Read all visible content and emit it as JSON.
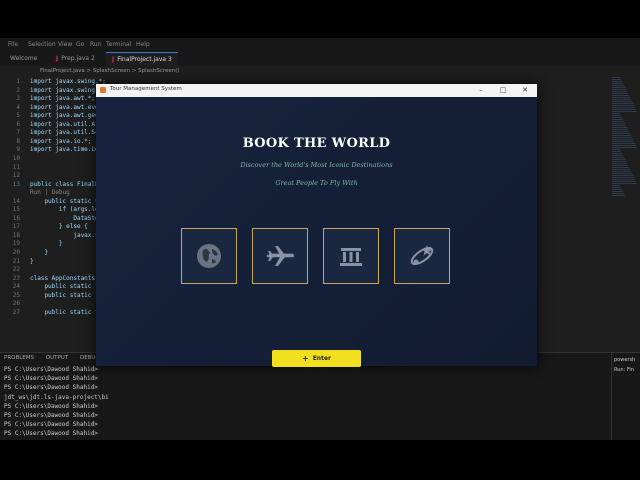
{
  "vscode": {
    "menu": [
      "File",
      "Selection",
      "View",
      "Go",
      "Run",
      "Terminal",
      "Help"
    ],
    "tabs": [
      {
        "label": "Welcome",
        "active": false
      },
      {
        "label": "Prep.java 2",
        "active": false
      },
      {
        "label": "FinalProject.java 3",
        "active": true
      }
    ],
    "breadcrumb": "FinalProject.java > SplashScreen > SplashScreen()",
    "code_lines": [
      {
        "n": "1",
        "text": "import javax.swing.*;"
      },
      {
        "n": "2",
        "text": "import javax.swing.b"
      },
      {
        "n": "3",
        "text": "import java.awt.*;"
      },
      {
        "n": "4",
        "text": "import java.awt.eve"
      },
      {
        "n": "5",
        "text": "import java.awt.geom"
      },
      {
        "n": "6",
        "text": "import java.util.Arr"
      },
      {
        "n": "7",
        "text": "import java.util.Sca"
      },
      {
        "n": "8",
        "text": "import java.io.*;"
      },
      {
        "n": "9",
        "text": "import java.time.Loc"
      },
      {
        "n": "10",
        "text": ""
      },
      {
        "n": "11",
        "text": ""
      },
      {
        "n": "12",
        "text": ""
      },
      {
        "n": "13",
        "text": "public class FinalPr"
      },
      {
        "n": "",
        "text": "Run | Debug"
      },
      {
        "n": "14",
        "text": "    public static vo"
      },
      {
        "n": "15",
        "text": "        if (args.le"
      },
      {
        "n": "16",
        "text": "            DataSto"
      },
      {
        "n": "17",
        "text": "        } else {"
      },
      {
        "n": "18",
        "text": "            javax.sw"
      },
      {
        "n": "19",
        "text": "        }"
      },
      {
        "n": "20",
        "text": "    }"
      },
      {
        "n": "21",
        "text": "}"
      },
      {
        "n": "22",
        "text": ""
      },
      {
        "n": "23",
        "text": "class AppConstants {"
      },
      {
        "n": "24",
        "text": "    public static fi"
      },
      {
        "n": "25",
        "text": "    public static fi"
      },
      {
        "n": "26",
        "text": ""
      },
      {
        "n": "27",
        "text": "    public static fi"
      }
    ],
    "panel_tabs": [
      "PROBLEMS",
      "OUTPUT",
      "DEBUG CO"
    ],
    "terminal_lines": [
      "PS C:\\Users\\Dawood Shahid>",
      "PS C:\\Users\\Dawood Shahid>",
      "PS C:\\Users\\Dawood Shahid>",
      "jdt_ws\\jdt.ls-java-project\\bi",
      "PS C:\\Users\\Dawood Shahid>",
      "PS C:\\Users\\Dawood Shahid>",
      "PS C:\\Users\\Dawood Shahid>",
      "PS C:\\Users\\Dawood Shahid>",
      "jdt_ws\\jdt.ls-java-project\\bi",
      "PS C:\\Users\\Dawood Shahid>  & 'C:\\Program Files\\Java\\jdk-25.0.2\\bin\\java.exe' '-XX:+ShowCodeDetailsInExceptionMessages' '-cp' 'C:\\Users\\Dawood Shahid\\AppData\\Local\\Temp\\vscodesws_8e26b\\",
      "jdt_ws\\jdt.ls-java-project\\bin' 'FinalProject'"
    ],
    "terminal_side": [
      "powersh",
      "Run: Fin"
    ]
  },
  "app": {
    "window_title": "Tour Management System",
    "heading": "BOOK THE WORLD",
    "tagline": "Discover the World's Most Iconic Destinations",
    "subtagline": "Great People To Fly With",
    "cards": [
      {
        "icon": "globe-icon"
      },
      {
        "icon": "airplane-icon"
      },
      {
        "icon": "landmark-icon"
      },
      {
        "icon": "orbit-icon"
      }
    ],
    "enter_label": "Enter",
    "colors": {
      "accent": "#f2e020",
      "card_border": "#c8a85a",
      "tagline": "#7fb7a6",
      "background": "#14213c"
    }
  }
}
